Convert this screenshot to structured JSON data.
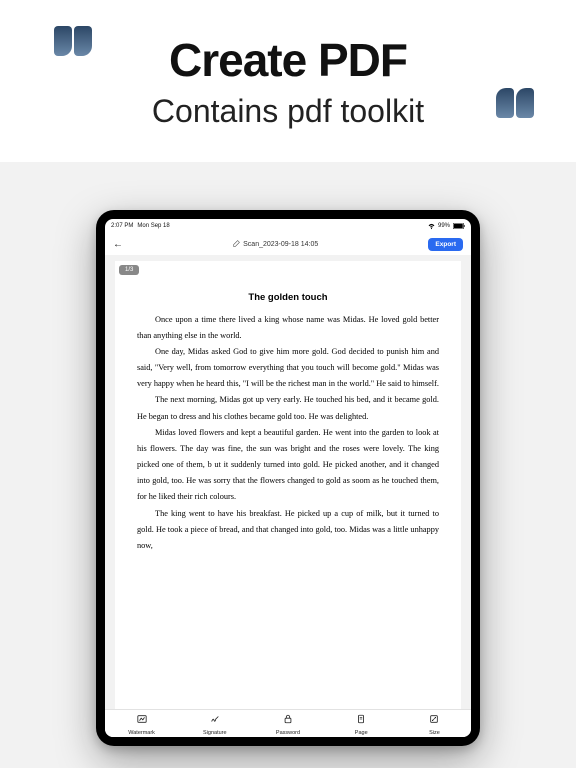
{
  "hero": {
    "title": "Create PDF",
    "subtitle": "Contains pdf toolkit"
  },
  "status": {
    "time": "2:07 PM",
    "date": "Mon Sep 18",
    "battery": "99%"
  },
  "topbar": {
    "doc_title": "Scan_2023-09-18 14:05",
    "export_label": "Export"
  },
  "page_badge": "1/3",
  "story": {
    "title": "The golden touch",
    "p1": "Once upon a time there lived a king whose name was Midas. He loved gold better than anything else in the world.",
    "p2": "One day, Midas asked God to give him more gold. God decided to punish him and said, \"Very well, from tomorrow everything  that you touch will become gold.\" Midas was very happy when he heard this, \"I will be the richest man in the world.\" He said to himself.",
    "p3": "The next morning, Midas got up very early. He touched his bed, and it became gold. He began to dress and his clothes became gold too. He was delighted.",
    "p4": "Midas loved flowers and kept a beautiful garden. He went into the garden to look at his flowers. The day was fine, the sun was bright and the roses were lovely. The king picked one of them, b ut it suddenly turned into gold. He picked another, and it changed into gold, too. He was sorry that the flowers changed to gold as soom as he touched them, for he liked their rich colours.",
    "p5": "The king went to have his breakfast. He picked up a cup of milk, but it turned to gold. He took a piece of bread, and that changed into gold, too. Midas was a little unhappy now,"
  },
  "tabs": {
    "watermark": "Watermark",
    "signature": "Signature",
    "password": "Password",
    "page": "Page",
    "size": "Size"
  }
}
